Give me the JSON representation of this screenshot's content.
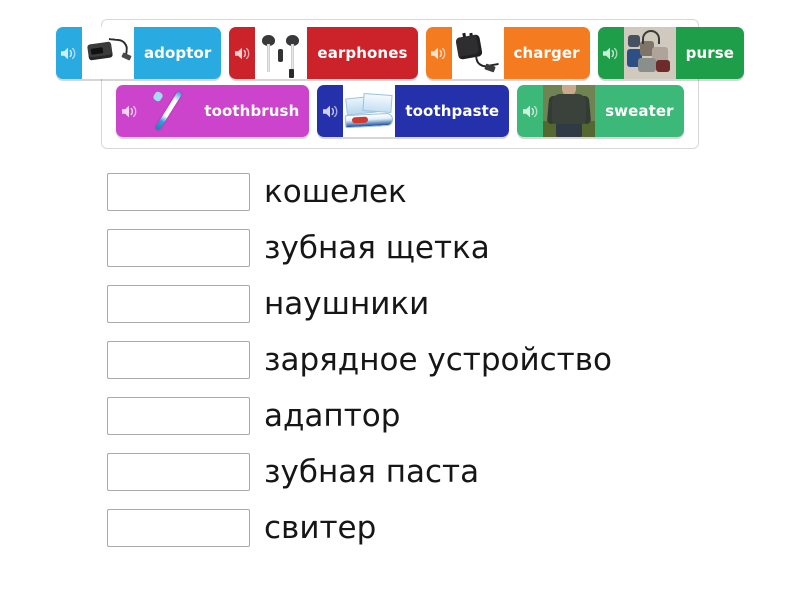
{
  "app": {
    "type": "vocabulary-matching-exercise",
    "background_color": "#ffffff"
  },
  "tile_bank": {
    "border_color": "#d8d8d8",
    "rows": [
      [
        {
          "label": "adoptor",
          "color": "#29abe2",
          "icon": "speaker-icon",
          "image": "adaptor-dongle-photo",
          "image_bg": "#ffffff"
        },
        {
          "label": "earphones",
          "color": "#cc2229",
          "icon": "speaker-icon",
          "image": "earphones-photo",
          "image_bg": "#ffffff"
        },
        {
          "label": "charger",
          "color": "#f47b20",
          "icon": "speaker-icon",
          "image": "wall-charger-photo",
          "image_bg": "#ffffff"
        },
        {
          "label": "purse",
          "color": "#1f9e4a",
          "icon": "speaker-icon",
          "image": "purses-photo",
          "image_bg": "#cfc9be"
        }
      ],
      [
        {
          "label": "toothbrush",
          "color": "#cc44cc",
          "icon": "speaker-icon",
          "image": "toothbrush-photo",
          "image_bg": "#cc44cc"
        },
        {
          "label": "toothpaste",
          "color": "#2531ab",
          "icon": "speaker-icon",
          "image": "toothpaste-photo",
          "image_bg": "#ffffff"
        },
        {
          "label": "sweater",
          "color": "#3cb878",
          "icon": "speaker-icon",
          "image": "sweater-photo",
          "image_bg": "#6f8452"
        }
      ]
    ]
  },
  "answers": {
    "box_border_color": "#a9a9a9",
    "items": [
      {
        "word": "кошелек",
        "box_value": ""
      },
      {
        "word": "зубная щетка",
        "box_value": ""
      },
      {
        "word": "наушники",
        "box_value": ""
      },
      {
        "word": "зарядное устройство",
        "box_value": ""
      },
      {
        "word": "адаптор",
        "box_value": ""
      },
      {
        "word": "зубная паста",
        "box_value": ""
      },
      {
        "word": "свитер",
        "box_value": ""
      }
    ]
  }
}
